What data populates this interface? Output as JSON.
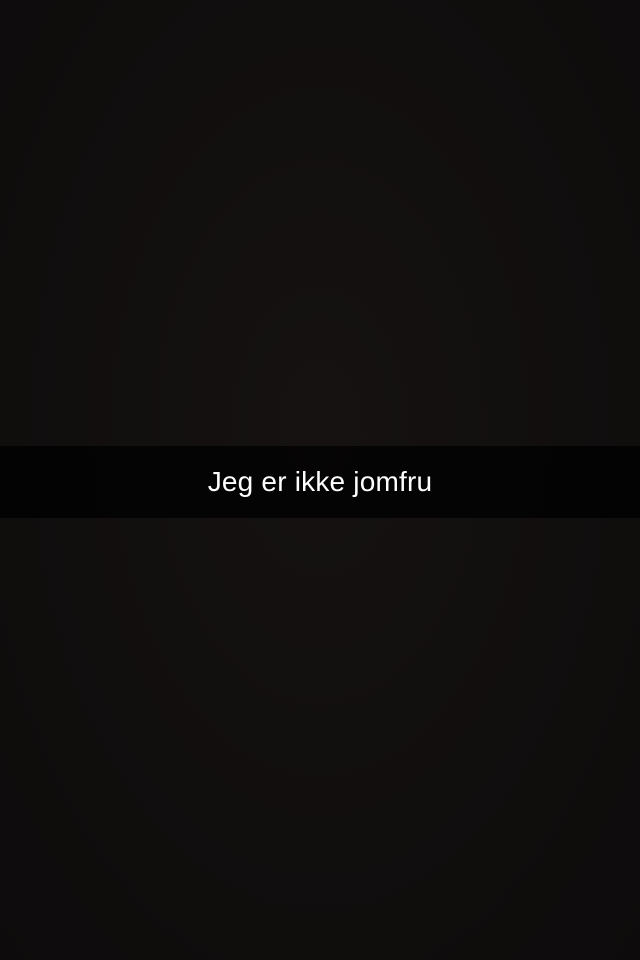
{
  "caption": {
    "text": "Jeg er ikke jomfru"
  },
  "colors": {
    "background": "#120f0f",
    "caption_bar": "#000000",
    "caption_text": "#ffffff"
  }
}
